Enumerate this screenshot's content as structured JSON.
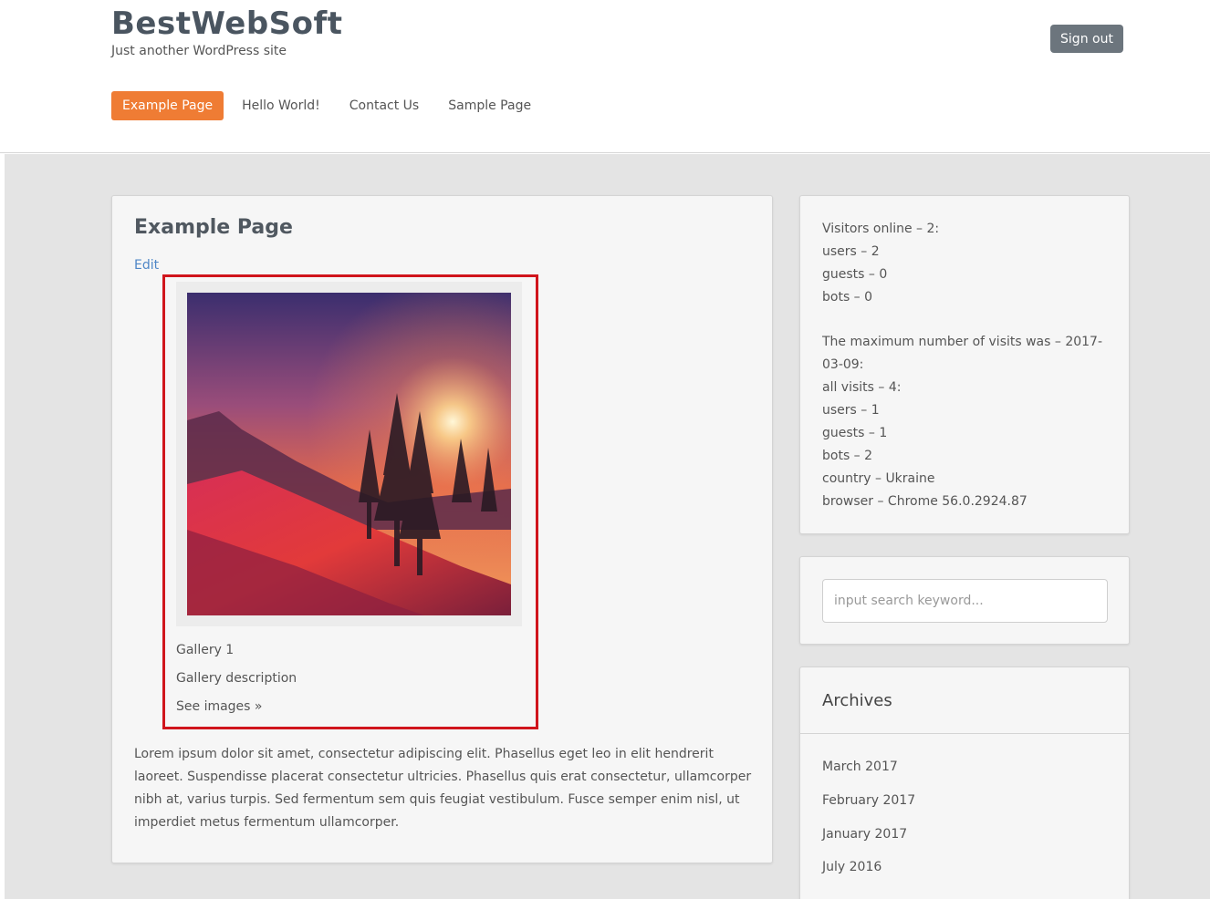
{
  "site": {
    "title": "BestWebSoft",
    "tagline": "Just another WordPress site",
    "signout_label": "Sign out"
  },
  "nav": {
    "items": [
      {
        "label": "Example Page",
        "active": true
      },
      {
        "label": "Hello World!",
        "active": false
      },
      {
        "label": "Contact Us",
        "active": false
      },
      {
        "label": "Sample Page",
        "active": false
      }
    ]
  },
  "main": {
    "page_title": "Example Page",
    "edit_label": "Edit",
    "gallery": {
      "title": "Gallery 1",
      "description": "Gallery description",
      "see_images": "See images »"
    },
    "body_text": "Lorem ipsum dolor sit amet, consectetur adipiscing elit. Phasellus eget leo in elit hendrerit laoreet. Suspendisse placerat consectetur ultricies. Phasellus quis erat consectetur, ullamcorper nibh at, varius turpis. Sed fermentum sem quis feugiat vestibulum. Fusce semper enim nisl, ut imperdiet metus fermentum ullamcorper."
  },
  "visitors": {
    "online": "Visitors online – 2:",
    "users": "users – 2",
    "guests": "guests – 0",
    "bots": "bots – 0",
    "max_line1": "The maximum number of visits was – 2017-",
    "max_line2": "03-09:",
    "all_visits": "all visits – 4:",
    "max_users": "users – 1",
    "max_guests": "guests – 1",
    "max_bots": "bots – 2",
    "country": "country – Ukraine",
    "browser": "browser – Chrome 56.0.2924.87"
  },
  "search": {
    "placeholder": "input search keyword..."
  },
  "archives": {
    "title": "Archives",
    "items": [
      "March 2017",
      "February 2017",
      "January 2017",
      "July 2016"
    ]
  },
  "colors": {
    "accent": "#ef7c34",
    "highlight_frame": "#d0151c",
    "link": "#4f87c7"
  }
}
